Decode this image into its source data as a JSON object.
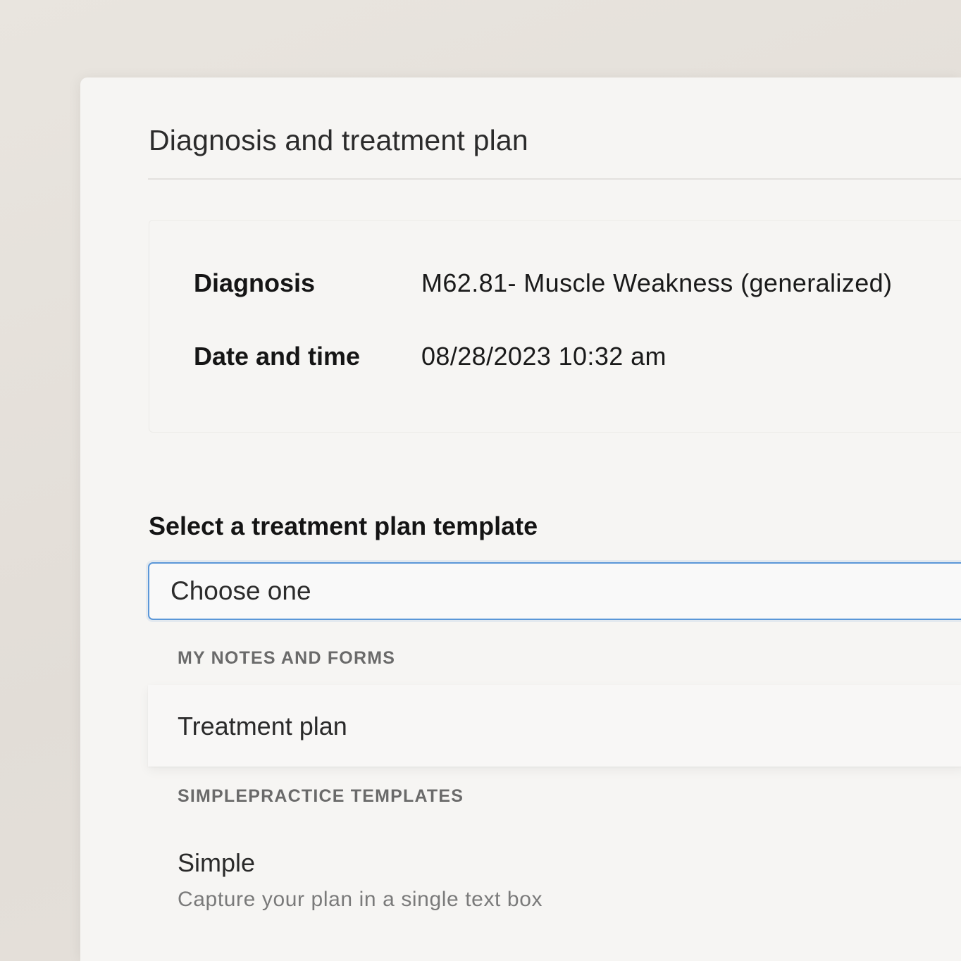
{
  "page": {
    "title": "Diagnosis and treatment plan"
  },
  "details": {
    "diagnosis_label": "Diagnosis",
    "diagnosis_value": "M62.81- Muscle Weakness (generalized)",
    "datetime_label": "Date and time",
    "datetime_value": "08/28/2023 10:32 am"
  },
  "template_select": {
    "label": "Select a treatment plan template",
    "value": "Choose one",
    "groups": [
      {
        "header": "MY NOTES AND FORMS",
        "options": [
          {
            "label": "Treatment plan",
            "description": ""
          }
        ]
      },
      {
        "header": "SIMPLEPRACTICE TEMPLATES",
        "options": [
          {
            "label": "Simple",
            "description": "Capture your plan in a single text box"
          }
        ]
      }
    ]
  },
  "colors": {
    "background": "#e6e1db",
    "panel": "#f6f5f3",
    "focus_border": "#5b97d8"
  }
}
